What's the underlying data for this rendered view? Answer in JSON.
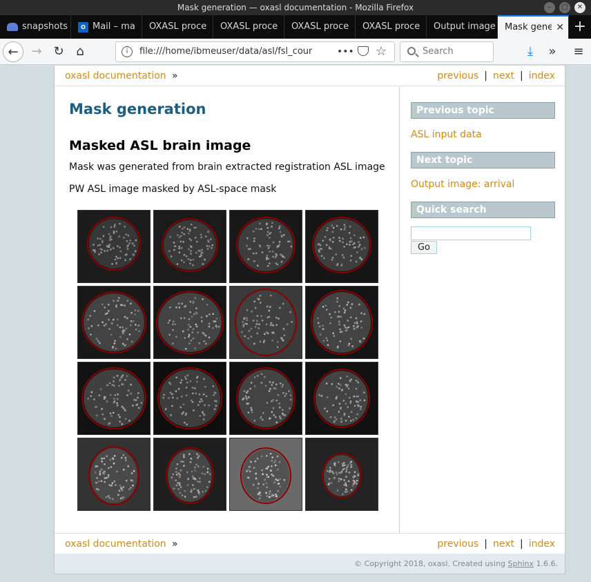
{
  "window": {
    "title": "Mask generation — oxasl documentation - Mozilla Firefox"
  },
  "tabs": [
    {
      "label": "snapshots",
      "icon": "cloud-icon",
      "active": false
    },
    {
      "label": "Mail – ma",
      "icon": "outlook-icon",
      "active": false
    },
    {
      "label": "OXASL proce",
      "active": false
    },
    {
      "label": "OXASL proce",
      "active": false
    },
    {
      "label": "OXASL proce",
      "active": false
    },
    {
      "label": "OXASL proce",
      "active": false
    },
    {
      "label": "Output image",
      "active": false
    },
    {
      "label": "Mask gene",
      "active": true
    }
  ],
  "nav": {
    "url": "file:///home/ibmeuser/data/asl/fsl_course/",
    "search_placeholder": "Search",
    "more": "•••"
  },
  "related": {
    "home": "oxasl documentation",
    "raquo": "»",
    "previous": "previous",
    "next": "next",
    "index": "index",
    "sep": "|"
  },
  "content": {
    "h1": "Mask generation",
    "h2": "Masked ASL brain image",
    "p1": "Mask was generated from brain extracted registration ASL image",
    "p2": "PW ASL image masked by ASL-space mask"
  },
  "sidebar": {
    "previous_topic_title": "Previous topic",
    "previous_topic_link": "ASL input data",
    "next_topic_title": "Next topic",
    "next_topic_link": "Output image: arrival",
    "quick_search_title": "Quick search",
    "go_label": "Go"
  },
  "footer": {
    "prefix": "© Copyright 2018, oxasl. Created using ",
    "sphinx": "Sphinx",
    "suffix": " 1.6.6."
  },
  "colors": {
    "link": "#d68a0e",
    "heading": "#1b5e83",
    "sidebar_header": "#b8c8cd",
    "mask_outline": "#8b0000"
  }
}
